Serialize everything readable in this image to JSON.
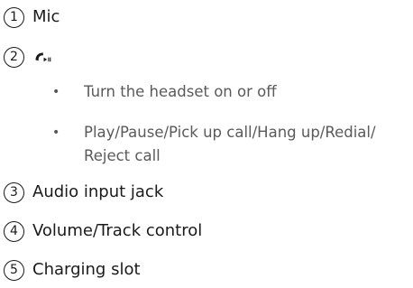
{
  "items": [
    {
      "number": "1",
      "label": "Mic"
    },
    {
      "number": "2",
      "icon": "call-play-pause-icon"
    },
    {
      "number": "3",
      "label": "Audio input jack"
    },
    {
      "number": "4",
      "label": "Volume/Track control"
    },
    {
      "number": "5",
      "label": "Charging slot"
    }
  ],
  "sub_items": [
    {
      "bullet": "•",
      "lines": [
        "Turn the headset on or off"
      ]
    },
    {
      "bullet": "•",
      "lines": [
        "Play/Pause/Pick up call/Hang up/Redial/",
        "Reject call"
      ]
    }
  ],
  "colors": {
    "text": "#1a1a1a",
    "sub_text": "#5a5a5a"
  }
}
